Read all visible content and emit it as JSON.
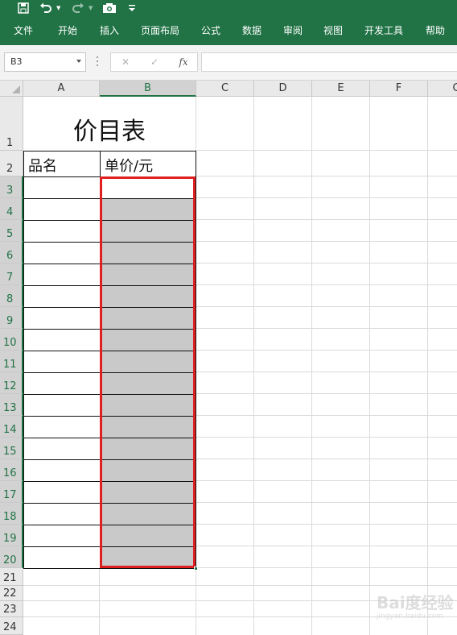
{
  "quick_access": {
    "icons": [
      "save-icon",
      "undo-icon",
      "redo-icon",
      "camera-icon",
      "customize-icon"
    ]
  },
  "ribbon": {
    "tabs": [
      "文件",
      "开始",
      "插入",
      "页面布局",
      "公式",
      "数据",
      "审阅",
      "视图",
      "开发工具",
      "帮助"
    ]
  },
  "formula_bar": {
    "name_box": "B3",
    "cancel_symbol": "✕",
    "enter_symbol": "✓",
    "function_symbol": "fx",
    "formula_value": ""
  },
  "sheet": {
    "columns": [
      "A",
      "B",
      "C",
      "D",
      "E",
      "F",
      "G"
    ],
    "rows": [
      "1",
      "2",
      "3",
      "4",
      "5",
      "6",
      "7",
      "8",
      "9",
      "10",
      "11",
      "12",
      "13",
      "14",
      "15",
      "16",
      "17",
      "18",
      "19",
      "20",
      "21",
      "22",
      "23",
      "24"
    ],
    "selected_column": "B",
    "selected_range": "B3:B20",
    "title": "价目表",
    "headers": {
      "A2": "品名",
      "B2": "单价/元"
    }
  },
  "colors": {
    "excel_green": "#217346",
    "selection_red": "#e02020",
    "cell_gray": "#c9c9c9"
  },
  "watermark": {
    "text": "Bai度经验",
    "sub": "jingyan.baidu.com"
  }
}
